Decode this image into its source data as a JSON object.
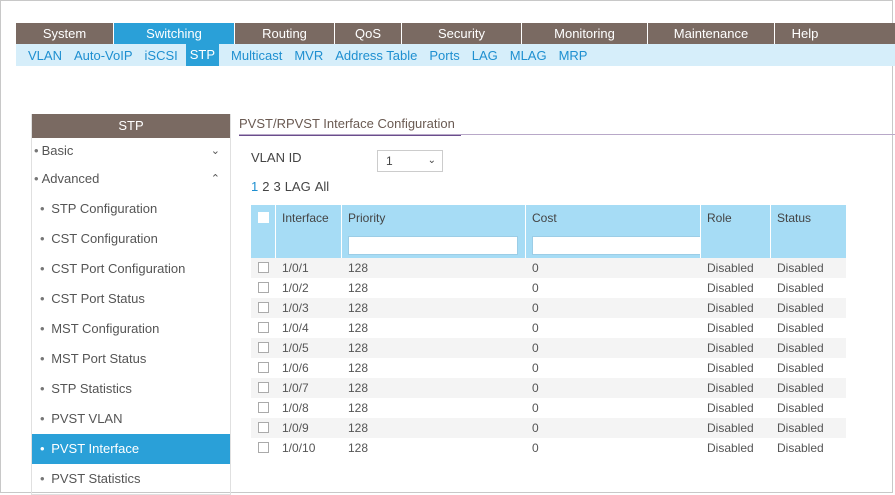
{
  "top_nav": [
    "System",
    "Switching",
    "Routing",
    "QoS",
    "Security",
    "Monitoring",
    "Maintenance",
    "Help"
  ],
  "top_nav_active": "Switching",
  "sub_nav": [
    "VLAN",
    "Auto-VoIP",
    "iSCSI",
    "STP",
    "Multicast",
    "MVR",
    "Address Table",
    "Ports",
    "LAG",
    "MLAG",
    "MRP"
  ],
  "sub_nav_active": "STP",
  "left_menu": {
    "title": "STP",
    "basic": "Basic",
    "advanced": "Advanced",
    "items": [
      "STP Configuration",
      "CST Configuration",
      "CST Port Configuration",
      "CST Port Status",
      "MST Configuration",
      "MST Port Status",
      "STP Statistics",
      "PVST VLAN",
      "PVST Interface",
      "PVST Statistics"
    ],
    "active": "PVST Interface"
  },
  "main": {
    "title": "PVST/RPVST Interface Configuration",
    "vlan_label": "VLAN ID",
    "vlan_value": "1",
    "pager": [
      "1",
      "2",
      "3",
      "LAG",
      "All"
    ]
  },
  "table": {
    "headers": [
      "Interface",
      "Priority",
      "Cost",
      "Role",
      "Status"
    ],
    "rows": [
      {
        "interface": "1/0/1",
        "priority": "128",
        "cost": "0",
        "role": "Disabled",
        "status": "Disabled"
      },
      {
        "interface": "1/0/2",
        "priority": "128",
        "cost": "0",
        "role": "Disabled",
        "status": "Disabled"
      },
      {
        "interface": "1/0/3",
        "priority": "128",
        "cost": "0",
        "role": "Disabled",
        "status": "Disabled"
      },
      {
        "interface": "1/0/4",
        "priority": "128",
        "cost": "0",
        "role": "Disabled",
        "status": "Disabled"
      },
      {
        "interface": "1/0/5",
        "priority": "128",
        "cost": "0",
        "role": "Disabled",
        "status": "Disabled"
      },
      {
        "interface": "1/0/6",
        "priority": "128",
        "cost": "0",
        "role": "Disabled",
        "status": "Disabled"
      },
      {
        "interface": "1/0/7",
        "priority": "128",
        "cost": "0",
        "role": "Disabled",
        "status": "Disabled"
      },
      {
        "interface": "1/0/8",
        "priority": "128",
        "cost": "0",
        "role": "Disabled",
        "status": "Disabled"
      },
      {
        "interface": "1/0/9",
        "priority": "128",
        "cost": "0",
        "role": "Disabled",
        "status": "Disabled"
      },
      {
        "interface": "1/0/10",
        "priority": "128",
        "cost": "0",
        "role": "Disabled",
        "status": "Disabled"
      }
    ]
  },
  "colors": {
    "nav_brown": "#7a6a62",
    "accent_blue": "#2aa0d8",
    "table_header": "#a6dcf5"
  }
}
